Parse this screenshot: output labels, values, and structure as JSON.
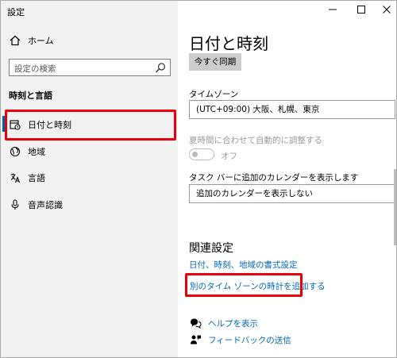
{
  "window": {
    "title": "設定"
  },
  "sidebar": {
    "home_label": "ホーム",
    "search_placeholder": "設定の検索",
    "section_title": "時刻と言語",
    "items": [
      {
        "label": "日付と時刻",
        "icon": "calendar-clock-icon",
        "selected": true
      },
      {
        "label": "地域",
        "icon": "globe-icon",
        "selected": false
      },
      {
        "label": "言語",
        "icon": "language-icon",
        "selected": false
      },
      {
        "label": "音声認識",
        "icon": "microphone-icon",
        "selected": false
      }
    ]
  },
  "main": {
    "title": "日付と時刻",
    "sync_button": "今すぐ同期",
    "timezone_label": "タイムゾーン",
    "timezone_value": "(UTC+09:00) 大阪、札幌、東京",
    "dst_label": "夏時間に合わせて自動的に調整する",
    "dst_toggle_label": "オフ",
    "dst_enabled": false,
    "taskbar_calendar_label": "タスク バーに追加のカレンダーを表示します",
    "taskbar_calendar_value": "追加のカレンダーを表示しない",
    "related_title": "関連設定",
    "related_links": [
      "日付、時刻、地域の書式設定",
      "別のタイム ゾーンの時計を追加する"
    ],
    "help_links": [
      {
        "label": "ヘルプを表示",
        "icon": "help-chat-icon"
      },
      {
        "label": "フィードバックの送信",
        "icon": "feedback-icon"
      }
    ]
  },
  "colors": {
    "accent": "#0063b1",
    "link": "#0067b8",
    "highlight": "#e8000b"
  }
}
